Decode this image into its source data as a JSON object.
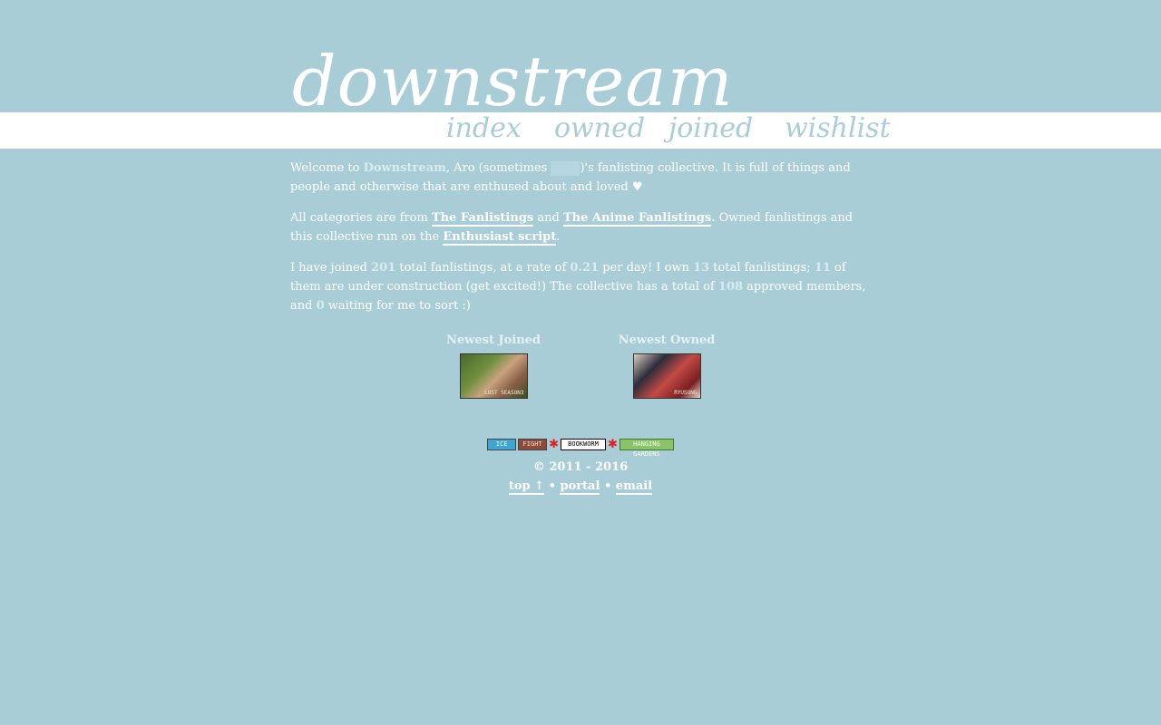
{
  "header": {
    "logo": "downstream",
    "nav": [
      {
        "label": "index"
      },
      {
        "label": "owned"
      },
      {
        "label": "joined"
      },
      {
        "label": "wishlist"
      }
    ]
  },
  "intro": {
    "p1": {
      "t1": "Welcome to ",
      "site": "Downstream",
      "t2": ", Aro (sometimes ",
      "t3": ")'s fanlisting collective. It is full of things and people and otherwise that are enthused about and loved ♥"
    },
    "p2": {
      "t1": "All categories are from ",
      "link1": "The Fanlistings",
      "t2": " and ",
      "link2": "The Anime Fanlistings",
      "t3": ". Owned fanlistings and this collective run on the ",
      "link3": "Enthusiast script",
      "t4": "."
    },
    "p3": {
      "t1": "I have joined ",
      "joined": "201",
      "t2": " total fanlistings, at a rate of ",
      "rate": "0.21",
      "t3": " per day! I own ",
      "owned": "13",
      "t4": " total fanlistings; ",
      "construction": "11",
      "t5": " of them are under construction (get excited!) The collective has a total of ",
      "members": "108",
      "t6": " approved members, and ",
      "pending": "0",
      "t7": " waiting for me to sort :)"
    }
  },
  "newest": {
    "joined": {
      "title": "Newest Joined",
      "caption": "LOST SEASON3"
    },
    "owned": {
      "title": "Newest Owned",
      "caption": "RYUSUNG"
    }
  },
  "footer": {
    "buttons": [
      "ICE",
      "FIGHT",
      "BOOKWORM",
      "HANGING GARDENS"
    ],
    "copyright": "© 2011 - 2016",
    "links": [
      "top ↑",
      "portal",
      "email"
    ],
    "separator": " • "
  },
  "colors": {
    "background": "#a9cdd6",
    "band": "#ffffff",
    "nav_text": "#a9cdd6",
    "highlight": "#d7ecf1"
  }
}
